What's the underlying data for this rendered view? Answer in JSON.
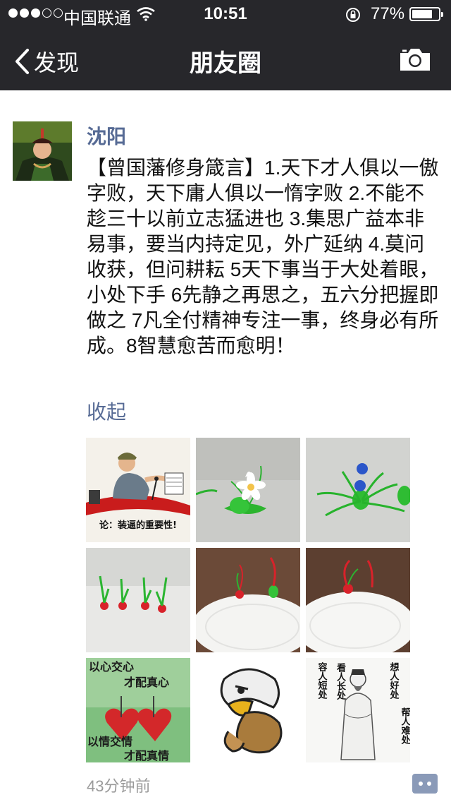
{
  "status_bar": {
    "carrier": "中国联通",
    "time": "10:51",
    "battery_percent": "77%",
    "battery_level": 0.77,
    "signal_bars_filled": 3,
    "signal_bars_total": 5
  },
  "nav": {
    "back_label": "发现",
    "title": "朋友圈",
    "camera_icon": "camera-icon"
  },
  "post": {
    "author": "沈阳",
    "text": "【曾国藩修身箴言】1.天下才人俱以一傲字败，天下庸人俱以一惰字败 2.不能不趁三十以前立志猛进也 3.集思广益本非易事，要当内持定见，外广延纳 4.莫问收获，但问耕耘 5天下事当于大处着眼，小处下手 6先静之再思之，五六分把握即做之 7凡全付精神专注一事，终身必有所成。8智慧愈苦而愈明！",
    "collapse_label": "收起",
    "time_ago": "43分钟前",
    "images": [
      {
        "caption": "论：装逼的重要性!"
      },
      {
        "caption": ""
      },
      {
        "caption": ""
      },
      {
        "caption": ""
      },
      {
        "caption": ""
      },
      {
        "caption": ""
      },
      {
        "caption_top": "以心交心",
        "caption_top2": "才配真心",
        "caption_bottom": "以情交情",
        "caption_bottom2": "才配真情"
      },
      {
        "caption": ""
      },
      {
        "left_col1": "看人长处",
        "left_col2": "容人短处",
        "right_col1": "想人好处",
        "right_col2": "帮人难处"
      }
    ]
  },
  "colors": {
    "nav_bg": "#27272b",
    "link_blue": "#576b95",
    "meta_gray": "#9a9a9a"
  }
}
